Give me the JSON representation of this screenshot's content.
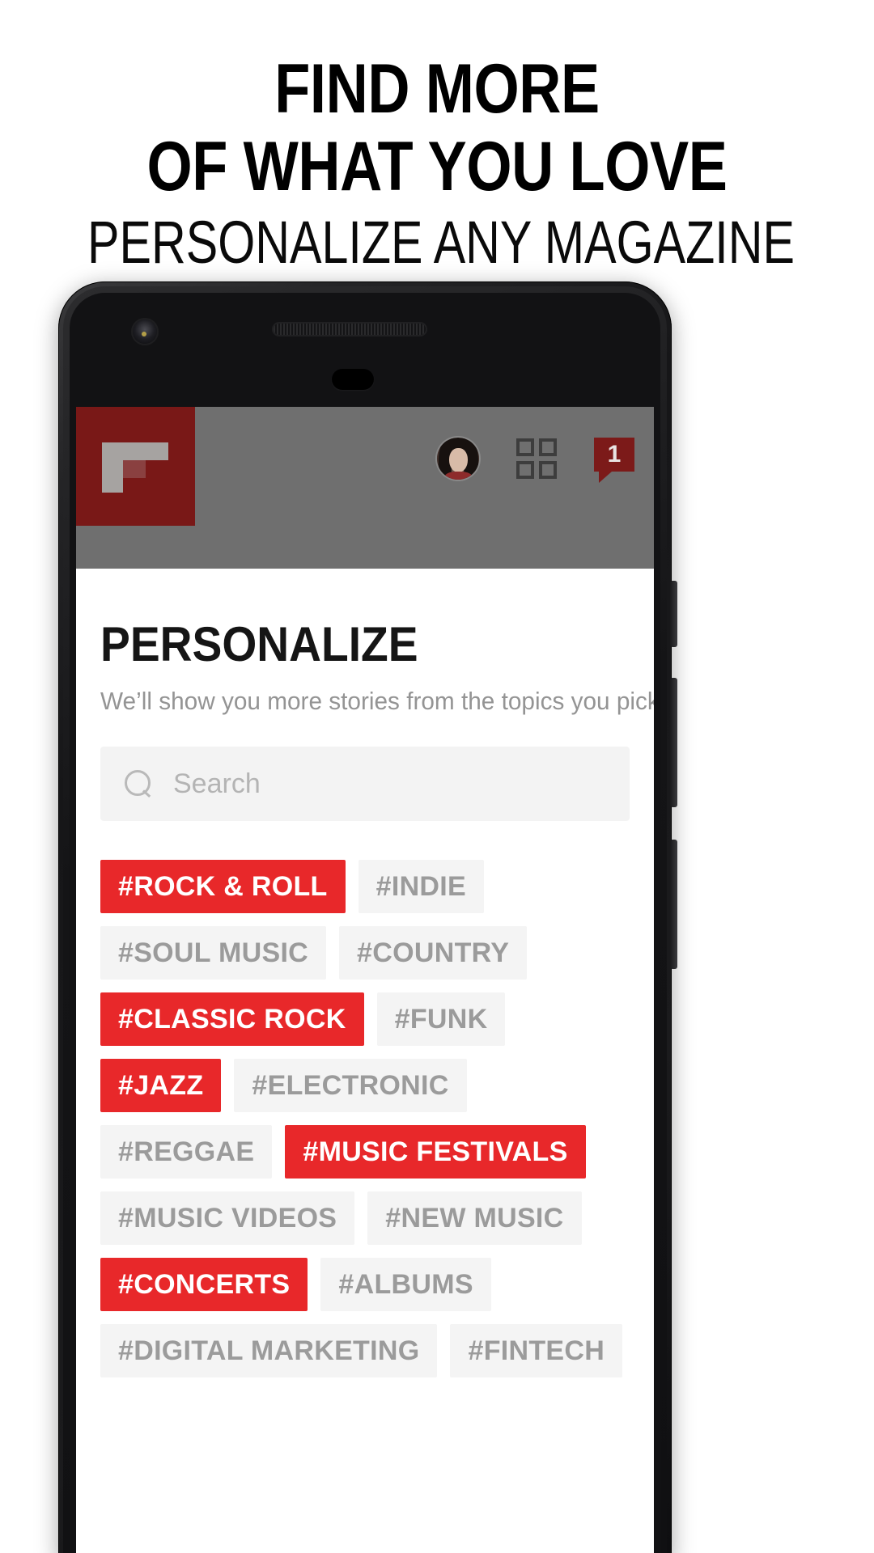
{
  "promo": {
    "line1": "FIND MORE",
    "line2": "OF WHAT YOU LOVE",
    "line3": "PERSONALIZE ANY MAGAZINE"
  },
  "app": {
    "header": {
      "logo_name": "flipboard-logo",
      "logo_color": "#791817",
      "bar_color": "#6f6f6f",
      "avatar_name": "user-avatar",
      "grid_icon_name": "grid-icon",
      "notification_icon_name": "notification-badge-icon",
      "notification_count": "1",
      "notification_color": "#7c1a19"
    },
    "page": {
      "title": "PERSONALIZE",
      "subtitle": "We’ll show you more stories from the topics you pick."
    },
    "search": {
      "icon_name": "search-icon",
      "placeholder": "Search",
      "value": ""
    },
    "accent_selected": "#e8282a",
    "accent_unselected": "#f4f4f4",
    "topics": [
      {
        "label": "#ROCK & ROLL",
        "selected": true
      },
      {
        "label": "#INDIE",
        "selected": false
      },
      {
        "label": "#SOUL MUSIC",
        "selected": false
      },
      {
        "label": "#COUNTRY",
        "selected": false
      },
      {
        "label": "#CLASSIC ROCK",
        "selected": true
      },
      {
        "label": "#FUNK",
        "selected": false
      },
      {
        "label": "#JAZZ",
        "selected": true
      },
      {
        "label": "#ELECTRONIC",
        "selected": false
      },
      {
        "label": "#REGGAE",
        "selected": false
      },
      {
        "label": "#MUSIC FESTIVALS",
        "selected": true
      },
      {
        "label": "#MUSIC VIDEOS",
        "selected": false
      },
      {
        "label": "#NEW MUSIC",
        "selected": false
      },
      {
        "label": "#CONCERTS",
        "selected": true
      },
      {
        "label": "#ALBUMS",
        "selected": false
      },
      {
        "label": "#DIGITAL MARKETING",
        "selected": false
      },
      {
        "label": "#FINTECH",
        "selected": false
      }
    ]
  }
}
